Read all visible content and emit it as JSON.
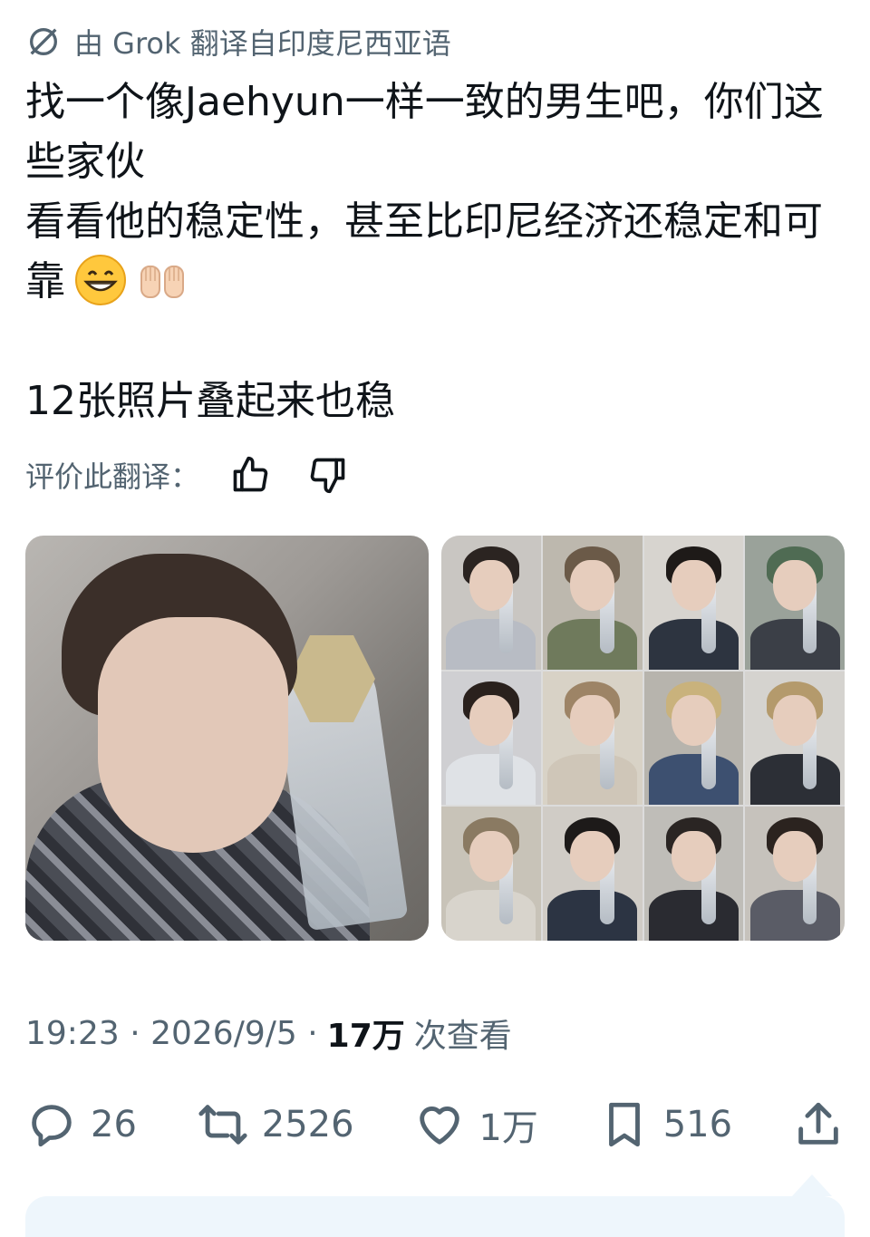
{
  "translation": {
    "label": "由 Grok 翻译自印度尼西亚语",
    "icon": "translate-slash-icon"
  },
  "tweet": {
    "line1": "找一个像Jaehyun一样一致的男生吧，你们这些家伙",
    "line2": "看看他的稳定性，甚至比印尼经济还稳定和可靠",
    "line3": "12张照片叠起来也稳",
    "emoji1": "😁",
    "emoji2": "🙌🏻"
  },
  "rating": {
    "label": "评价此翻译：",
    "like_icon": "thumbs-up-icon",
    "dislike_icon": "thumbs-down-icon"
  },
  "media": {
    "photo_count": 12
  },
  "meta": {
    "time": "19:23 · 2026/9/5 · ",
    "views_count": "17万",
    "views_label": " 次查看"
  },
  "actions": {
    "replies": "26",
    "reposts": "2526",
    "likes": "1万",
    "bookmarks": "516"
  },
  "colors": {
    "text": "#0f1419",
    "secondary": "#536471",
    "card": "#eef6fc"
  }
}
